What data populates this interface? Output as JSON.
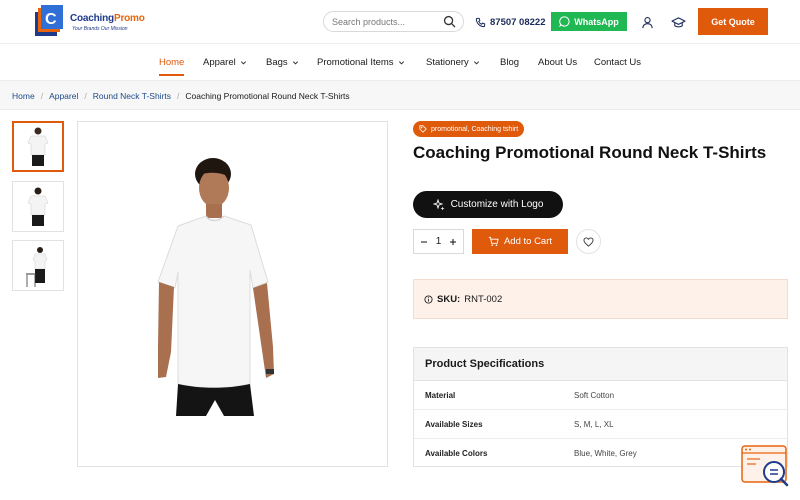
{
  "header": {
    "logo": {
      "brand_a": "Coaching",
      "brand_b": "Promo",
      "tagline": "Your Brands Our Mission"
    },
    "search": {
      "placeholder": "Search products..."
    },
    "phone": "87507 08222",
    "whatsapp_label": "WhatsApp",
    "quote_label": "Get Quote"
  },
  "nav": {
    "items": [
      {
        "label": "Home",
        "active": true
      },
      {
        "label": "Apparel",
        "dropdown": true
      },
      {
        "label": "Bags",
        "dropdown": true
      },
      {
        "label": "Promotional Items",
        "dropdown": true
      },
      {
        "label": "Stationery",
        "dropdown": true
      },
      {
        "label": "Blog"
      },
      {
        "label": "About Us"
      },
      {
        "label": "Contact Us"
      }
    ]
  },
  "breadcrumb": {
    "items": [
      "Home",
      "Apparel",
      "Round Neck T-Shirts"
    ],
    "current": "Coaching Promotional Round Neck T-Shirts"
  },
  "product": {
    "tags": "promotional, Coaching tshirt",
    "title": "Coaching Promotional Round Neck T-Shirts",
    "customize_label": "Customize with Logo",
    "quantity": "1",
    "add_to_cart_label": "Add to Cart",
    "sku_label": "SKU:",
    "sku_value": "RNT-002"
  },
  "specs": {
    "title": "Product Specifications",
    "rows": [
      {
        "key": "Material",
        "value": "Soft Cotton"
      },
      {
        "key": "Available Sizes",
        "value": "S, M, L, XL"
      },
      {
        "key": "Available Colors",
        "value": "Blue, White, Grey"
      }
    ]
  },
  "colors": {
    "accent": "#e05a0c",
    "whatsapp": "#1fb853",
    "brand_blue": "#1e3a8a"
  },
  "icons": [
    "logo-mark",
    "search-icon",
    "phone-icon",
    "whatsapp-icon",
    "user-icon",
    "graduation-cap-icon",
    "chevron-down-icon",
    "tag-icon",
    "sparkle-icon",
    "minus-icon",
    "plus-icon",
    "cart-icon",
    "heart-icon",
    "info-icon",
    "chat-widget-icon"
  ]
}
